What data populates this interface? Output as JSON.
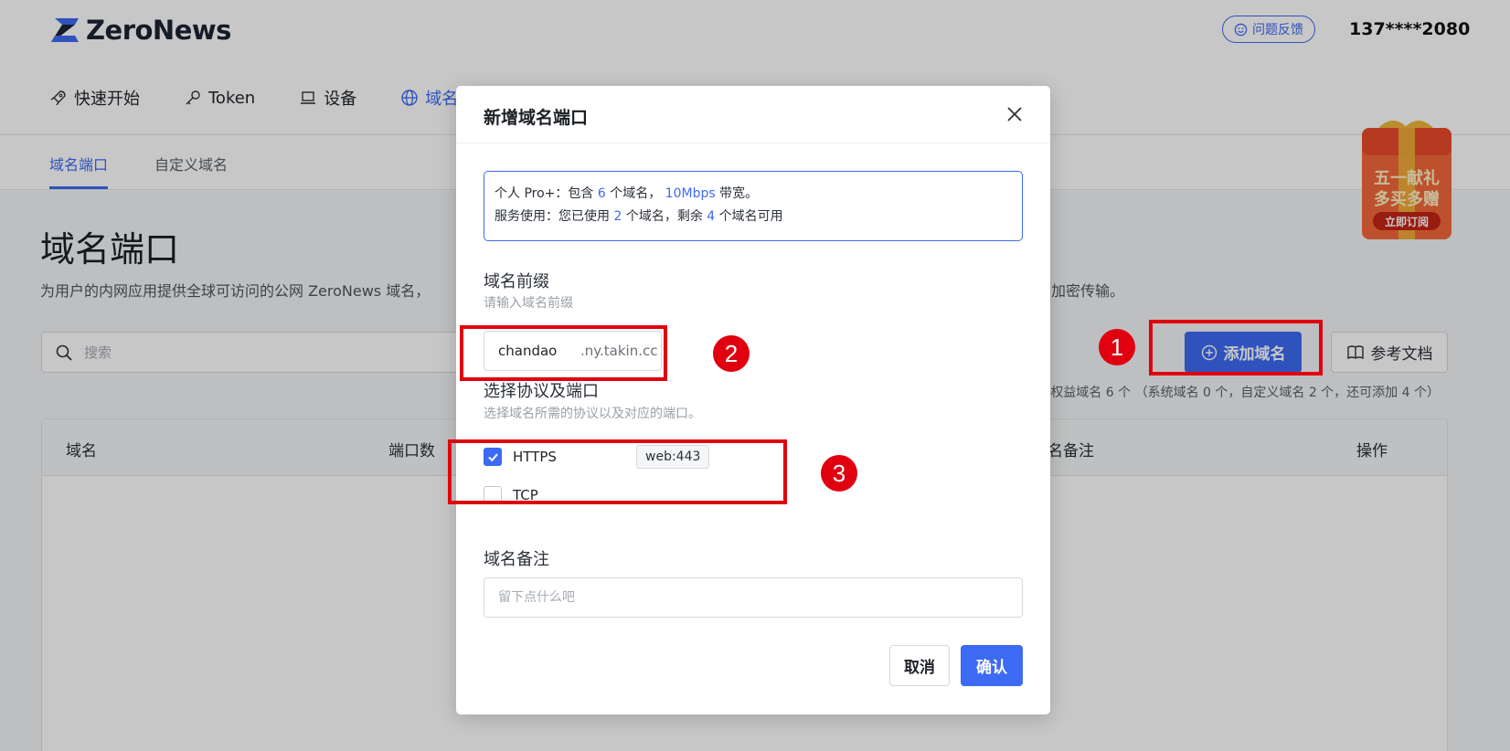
{
  "app": {
    "logo_text": "ZeroNews"
  },
  "header": {
    "feedback_label": "问题反馈",
    "user_phone": "137****2080"
  },
  "nav": {
    "items": [
      {
        "label": "快速开始",
        "icon": "rocket-icon"
      },
      {
        "label": "Token",
        "icon": "key-icon"
      },
      {
        "label": "设备",
        "icon": "laptop-icon"
      },
      {
        "label": "域名",
        "icon": "globe-icon"
      }
    ]
  },
  "subnav": {
    "tabs": [
      {
        "label": "域名端口"
      },
      {
        "label": "自定义域名"
      }
    ]
  },
  "page": {
    "title": "域名端口",
    "description": "为用户的内网应用提供全球可访问的公网 ZeroNews 域名，                                                                                        LS 证书，实现用户访问流量安全加密传输。",
    "search_placeholder": "搜索",
    "add_domain_label": "添加域名",
    "docs_label": "参考文档",
    "quota_text": "权益域名 6 个  （系统域名 0 个，自定义域名 2 个，还可添加 4 个）",
    "table_headers": [
      "域名",
      "端口数",
      "名备注",
      "操作"
    ]
  },
  "promo": {
    "line1": "五一献礼",
    "line2": "多买多赠",
    "cta": "立即订阅"
  },
  "modal": {
    "title": "新增域名端口",
    "info": {
      "line1_prefix": "个人 Pro+：包含 ",
      "domain_count": "6",
      "line1_mid": " 个域名， ",
      "bandwidth": "10Mbps",
      "line1_suffix": " 带宽。",
      "line2_prefix": "服务使用：您已使用 ",
      "used_count": "2",
      "line2_mid": " 个域名，剩余 ",
      "remaining_count": "4",
      "line2_suffix": " 个域名可用"
    },
    "prefix": {
      "label": "域名前缀",
      "hint": "请输入域名前缀",
      "value": "chandao",
      "suffix": ".ny.takin.cc"
    },
    "protocol": {
      "label": "选择协议及端口",
      "hint": "选择域名所需的协议以及对应的端口。",
      "options": [
        {
          "label": "HTTPS",
          "checked": true,
          "port": "web:443"
        },
        {
          "label": "TCP",
          "checked": false
        }
      ]
    },
    "note": {
      "label": "域名备注",
      "placeholder": "留下点什么吧"
    },
    "cancel_label": "取消",
    "confirm_label": "确认"
  },
  "annotations": [
    "1",
    "2",
    "3"
  ],
  "colors": {
    "accent": "#3d6af2",
    "annotation": "#e0000f"
  }
}
